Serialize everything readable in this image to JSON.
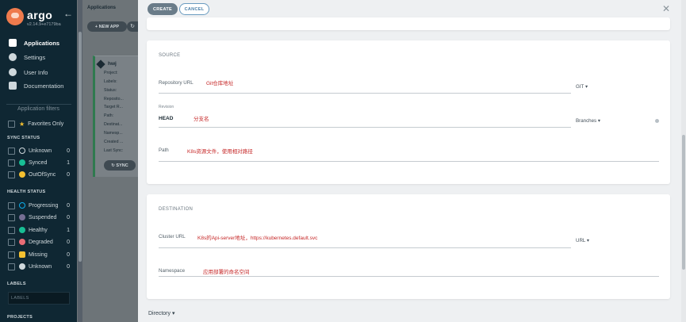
{
  "sidebar": {
    "brand": "argo",
    "version": "v2.14.9+e7179ba",
    "nav": [
      {
        "label": "Applications"
      },
      {
        "label": "Settings"
      },
      {
        "label": "User Info"
      },
      {
        "label": "Documentation"
      }
    ],
    "filters_title": "Application filters",
    "favorites_label": "Favorites Only",
    "sync_status": {
      "title": "SYNC STATUS",
      "items": [
        {
          "label": "Unknown",
          "count": "0",
          "color": "#cfd8dc"
        },
        {
          "label": "Synced",
          "count": "1",
          "color": "#18be94"
        },
        {
          "label": "OutOfSync",
          "count": "0",
          "color": "#f4c030"
        }
      ]
    },
    "health_status": {
      "title": "HEALTH STATUS",
      "items": [
        {
          "label": "Progressing",
          "count": "0",
          "color": "#0dadea"
        },
        {
          "label": "Suspended",
          "count": "0",
          "color": "#766f94"
        },
        {
          "label": "Healthy",
          "count": "1",
          "color": "#18be94"
        },
        {
          "label": "Degraded",
          "count": "0",
          "color": "#e96d76"
        },
        {
          "label": "Missing",
          "count": "0",
          "color": "#f4c030"
        },
        {
          "label": "Unknown",
          "count": "0",
          "color": "#cfd8dc"
        }
      ]
    },
    "labels_title": "LABELS",
    "labels_placeholder": "LABELS",
    "projects_title": "PROJECTS"
  },
  "apps_bg": {
    "breadcrumb": "Applications",
    "new_app": "+ NEW APP",
    "app_name": "hwj",
    "fields": [
      "Project:",
      "Labels:",
      "Status:",
      "Reposito...",
      "Target R...",
      "Path:",
      "Destinat...",
      "Namesp...",
      "Created ...",
      "Last Sync:"
    ],
    "sync_button": "SYNC"
  },
  "panel": {
    "create_label": "CREATE",
    "cancel_label": "CANCEL",
    "source": {
      "title": "SOURCE",
      "repo_label": "Repository URL",
      "repo_value": "Git仓库地址",
      "repo_type": "GIT",
      "revision_label": "Revision",
      "revision_value": "HEAD",
      "revision_note": "分支名",
      "revision_dropdown": "Branches",
      "path_label": "Path",
      "path_value": "K8s资源文件，使用相对路径"
    },
    "destination": {
      "title": "DESTINATION",
      "cluster_label": "Cluster URL",
      "cluster_value": "K8s的Api-server地址，https://kubernetes.default.svc",
      "cluster_type": "URL",
      "namespace_label": "Namespace",
      "namespace_value": "应用部署的命名空间"
    },
    "directory_label": "Directory"
  },
  "colors": {
    "sidebar_bg": "#0f2733",
    "accent_red": "#c62828",
    "synced": "#18be94"
  }
}
